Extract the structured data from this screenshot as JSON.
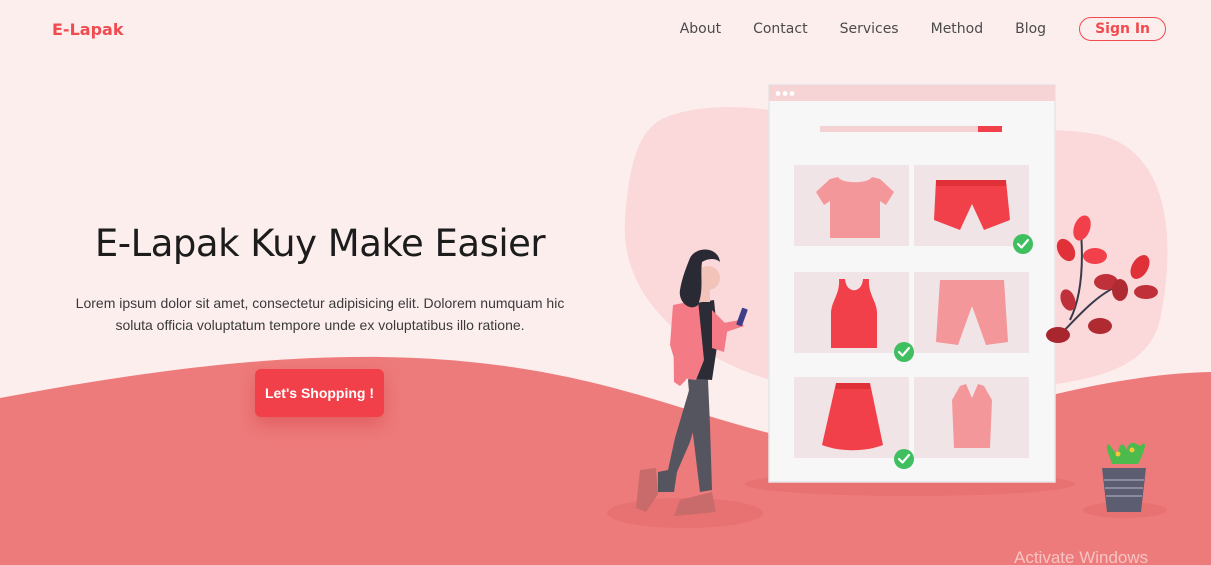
{
  "brand": {
    "logo": "E-Lapak"
  },
  "nav": {
    "items": [
      {
        "label": "About"
      },
      {
        "label": "Contact"
      },
      {
        "label": "Services"
      },
      {
        "label": "Method"
      },
      {
        "label": "Blog"
      }
    ],
    "signin_label": "Sign In"
  },
  "hero": {
    "title": "E-Lapak Kuy Make Easier",
    "description": "Lorem ipsum dolor sit amet, consectetur adipisicing elit. Dolorem numquam hic soluta officia voluptatum tempore unde ex voluptatibus illo ratione.",
    "cta_label": "Let's Shopping !"
  },
  "watermark": "Activate Windows",
  "colors": {
    "accent": "#f04b4f",
    "button": "#f2404a",
    "background": "#fdeeee",
    "wave": "#ee7b7b",
    "check": "#3fbf5f"
  },
  "illustration": {
    "products": [
      "tshirt",
      "shorts",
      "tank-top",
      "pants",
      "skirt",
      "vest"
    ],
    "checked": [
      "shorts",
      "tank-top",
      "skirt"
    ]
  }
}
